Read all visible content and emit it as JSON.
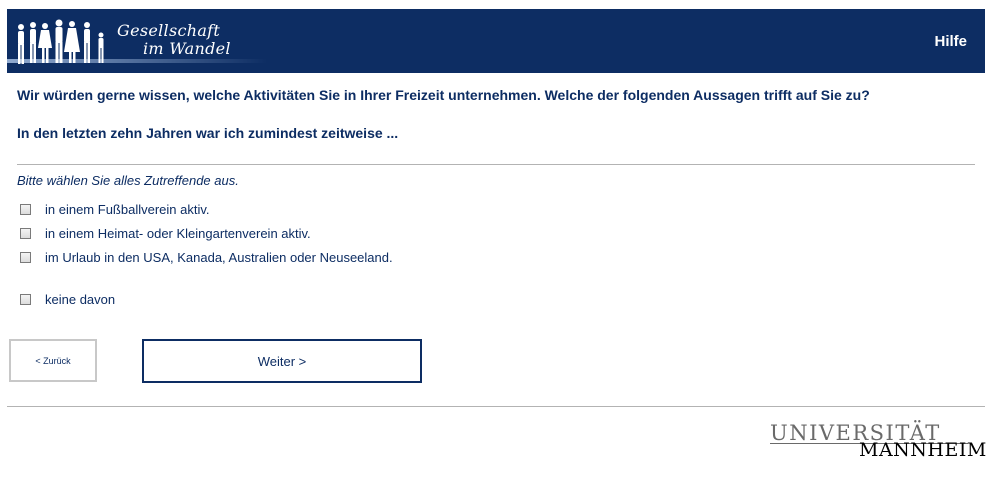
{
  "header": {
    "logo_line1": "Gesellschaft",
    "logo_line2": "im Wandel",
    "help_label": "Hilfe"
  },
  "question": {
    "text": "Wir würden gerne wissen, welche Aktivitäten Sie in Ihrer Freizeit unternehmen. Welche der folgenden Aussagen trifft auf Sie zu?",
    "subtext": "In den letzten zehn Jahren war ich zumindest zeitweise ...",
    "instruction": "Bitte wählen Sie alles Zutreffende aus."
  },
  "options": [
    {
      "label": "in einem Fußballverein aktiv.",
      "checked": false
    },
    {
      "label": "in einem Heimat- oder Kleingartenverein aktiv.",
      "checked": false
    },
    {
      "label": "im Urlaub in den USA, Kanada, Australien oder Neuseeland.",
      "checked": false
    },
    {
      "label": "keine davon",
      "checked": false
    }
  ],
  "nav": {
    "back_label": "< Zurück",
    "next_label": "Weiter >"
  },
  "footer": {
    "uni_line1": "UNIVERSITÄT",
    "uni_line2": "MANNHEIM"
  },
  "colors": {
    "brand_navy": "#0d2d63",
    "divider": "#b3b3b3"
  }
}
